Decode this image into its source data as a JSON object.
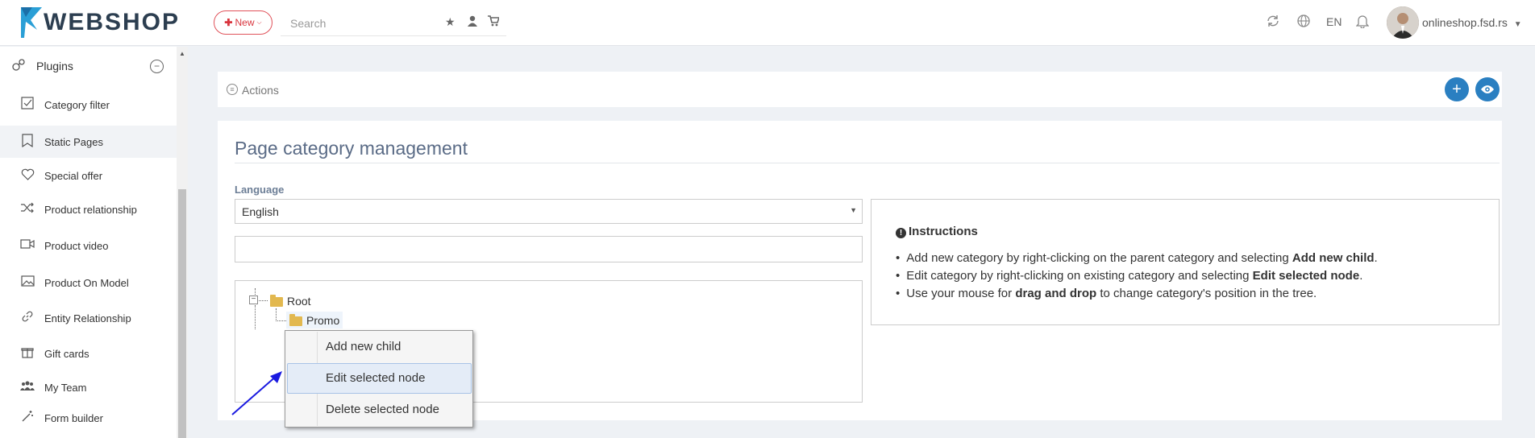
{
  "header": {
    "logo_text": "WEBSHOP",
    "new_button": "New",
    "search_placeholder": "Search",
    "language_code": "EN",
    "store_name": "onlineshop.fsd.rs"
  },
  "sidebar": {
    "section_title": "Plugins",
    "items": [
      {
        "label": "Category filter",
        "icon": "checkbox-icon"
      },
      {
        "label": "Static Pages",
        "icon": "bookmark-icon",
        "active": true
      },
      {
        "label": "Special offer",
        "icon": "heart-icon"
      },
      {
        "label": "Product relationship",
        "icon": "shuffle-icon"
      },
      {
        "label": "Product video",
        "icon": "video-icon"
      },
      {
        "label": "Product On Model",
        "icon": "image-icon"
      },
      {
        "label": "Entity Relationship",
        "icon": "link-icon"
      },
      {
        "label": "Gift cards",
        "icon": "gift-icon"
      },
      {
        "label": "My Team",
        "icon": "team-icon"
      },
      {
        "label": "Form builder",
        "icon": "wand-icon"
      }
    ]
  },
  "actions": {
    "label": "Actions"
  },
  "main": {
    "title": "Page category management",
    "language_label": "Language",
    "language_value": "English",
    "filter_value": "",
    "tree": {
      "root": "Root",
      "child": "Promo"
    },
    "context_menu": [
      "Add new child",
      "Edit selected node",
      "Delete selected node"
    ]
  },
  "instructions": {
    "title": "Instructions",
    "items": [
      {
        "pre": "Add new category by right-clicking on the parent category and selecting ",
        "bold": "Add new child",
        "post": "."
      },
      {
        "pre": "Edit category by right-clicking on existing category and selecting ",
        "bold": "Edit selected node",
        "post": "."
      },
      {
        "pre": "Use your mouse for ",
        "bold": "drag and drop",
        "post": " to change category's position in the tree."
      }
    ]
  },
  "colors": {
    "accent": "#2a7fc1",
    "new_button": "#d9353e",
    "folder": "#e2b84f"
  }
}
